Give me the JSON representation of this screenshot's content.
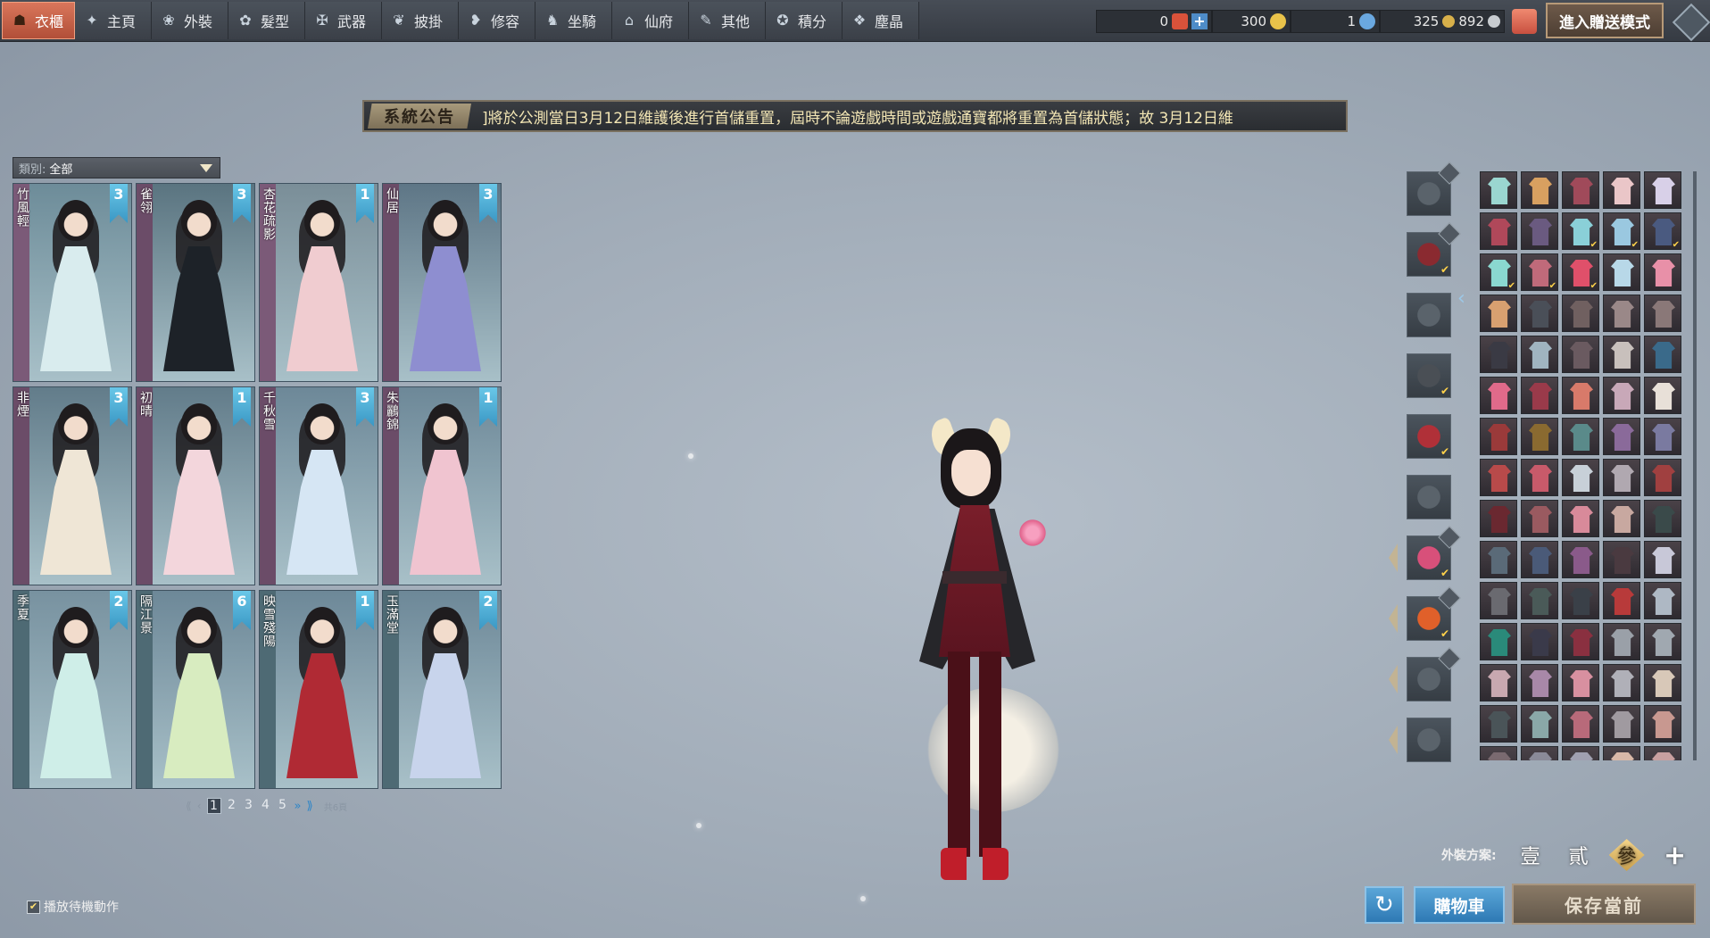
{
  "tabs": [
    {
      "label": "衣櫃",
      "icon": "wardrobe-icon",
      "glyph": "☗",
      "active": true
    },
    {
      "label": "主頁",
      "icon": "home-icon",
      "glyph": "✦"
    },
    {
      "label": "外裝",
      "icon": "outfit-icon",
      "glyph": "❀"
    },
    {
      "label": "髮型",
      "icon": "hairstyle-icon",
      "glyph": "✿"
    },
    {
      "label": "武器",
      "icon": "weapon-icon",
      "glyph": "✠"
    },
    {
      "label": "披掛",
      "icon": "cape-icon",
      "glyph": "❦"
    },
    {
      "label": "修容",
      "icon": "makeup-icon",
      "glyph": "❥"
    },
    {
      "label": "坐騎",
      "icon": "mount-icon",
      "glyph": "♞"
    },
    {
      "label": "仙府",
      "icon": "residence-icon",
      "glyph": "⌂"
    },
    {
      "label": "其他",
      "icon": "other-icon",
      "glyph": "✎"
    },
    {
      "label": "積分",
      "icon": "points-icon",
      "glyph": "✪"
    },
    {
      "label": "塵晶",
      "icon": "dust-crystal-icon",
      "glyph": "❖"
    }
  ],
  "currency": {
    "c1": {
      "value": "0",
      "icon": "red-token-icon",
      "color": "#d9523a"
    },
    "c2": {
      "value": "300",
      "icon": "gold-star-icon",
      "color": "#e8c24a"
    },
    "c3": {
      "value": "1",
      "icon": "shield-token-icon",
      "color": "#6aa8e0"
    },
    "c4": {
      "value": "325",
      "icon": "gold-coin-icon",
      "color": "#d8b04a"
    },
    "c5": {
      "value": "892",
      "icon": "silver-coin-icon",
      "color": "#c8ccd0"
    }
  },
  "gift_mode_label": "進入贈送模式",
  "notice": {
    "label": "系統公告",
    "text": "]將於公測當日3月12日維護後進行首儲重置，屆時不論遊戲時間或遊戲通寶都將重置為首儲狀態；故 3月12日維"
  },
  "category": {
    "label": "類別:",
    "value": "全部"
  },
  "outfits": [
    {
      "name": "竹風輕",
      "count": "3",
      "stripe": "#7b5a78",
      "bg": "#6d8c99",
      "robe": "#d9ecee"
    },
    {
      "name": "雀翎",
      "count": "3",
      "stripe": "#6b4c68",
      "bg": "#5a7480",
      "robe": "#1d2228"
    },
    {
      "name": "杏花疏影",
      "count": "1",
      "stripe": "#7b5a78",
      "bg": "#7a8e98",
      "robe": "#f0ccd0"
    },
    {
      "name": "仙居",
      "count": "3",
      "stripe": "#6b4c68",
      "bg": "#5e7686",
      "robe": "#8e8ed0"
    },
    {
      "name": "非煙",
      "count": "3",
      "stripe": "#6b4c68",
      "bg": "#627c8a",
      "robe": "#efe6d6"
    },
    {
      "name": "初晴",
      "count": "1",
      "stripe": "#6b4c68",
      "bg": "#627c8a",
      "robe": "#f3d6dc"
    },
    {
      "name": "千秋雪",
      "count": "3",
      "stripe": "#6b4c68",
      "bg": "#6d8898",
      "robe": "#d6e6f4"
    },
    {
      "name": "朱鸝錦",
      "count": "1",
      "stripe": "#6b4c68",
      "bg": "#6d8898",
      "robe": "#f0c4d0"
    },
    {
      "name": "季夏",
      "count": "2",
      "stripe": "#4e6a74",
      "bg": "#7892a0",
      "robe": "#cfeee8"
    },
    {
      "name": "隔江景",
      "count": "6",
      "stripe": "#4e6a74",
      "bg": "#6d8898",
      "robe": "#d8ecc0"
    },
    {
      "name": "映雪殘陽",
      "count": "1",
      "stripe": "#4e6a74",
      "bg": "#6d8898",
      "robe": "#b02a34"
    },
    {
      "name": "玉滿堂",
      "count": "2",
      "stripe": "#4e6a74",
      "bg": "#6d8898",
      "robe": "#c8d4ec"
    }
  ],
  "pagination": {
    "first": "⟪",
    "prev": "‹",
    "pages": [
      "1",
      "2",
      "3",
      "4",
      "5"
    ],
    "current": "1",
    "next": "»",
    "last": "⟫",
    "total": "共6頁"
  },
  "idle_label": "播放待機動作",
  "slots": [
    {
      "icon": "hair-slot-icon",
      "color": "#5a636b",
      "eye": true,
      "check": false,
      "arrow": false
    },
    {
      "icon": "cape-slot-icon",
      "color": "#8a2a30",
      "eye": true,
      "check": true,
      "arrow": false
    },
    {
      "icon": "top-slot-icon",
      "color": "#5a636b",
      "eye": false,
      "check": false,
      "arrow": false
    },
    {
      "icon": "bracer-slot-icon",
      "color": "#4a4f55",
      "eye": false,
      "check": true,
      "arrow": false
    },
    {
      "icon": "shoes-slot-icon",
      "color": "#b03038",
      "eye": false,
      "check": true,
      "arrow": false
    },
    {
      "icon": "skirt-slot-icon",
      "color": "#5a636b",
      "eye": false,
      "check": false,
      "arrow": false
    },
    {
      "icon": "flower-accessory-icon",
      "color": "#d8507a",
      "eye": true,
      "check": true,
      "arrow": true
    },
    {
      "icon": "gourd-accessory-icon",
      "color": "#e0602a",
      "eye": true,
      "check": true,
      "arrow": true
    },
    {
      "icon": "back-accessory-icon",
      "color": "#5a636b",
      "eye": true,
      "check": false,
      "arrow": true
    },
    {
      "icon": "wings-slot-icon",
      "color": "#5a636b",
      "eye": false,
      "check": false,
      "arrow": true
    }
  ],
  "grid_palette": [
    "#9ad6d0",
    "#d8a060",
    "#a04a5a",
    "#eac6c8",
    "#d8d0e8",
    "#b0485a",
    "#6a5a80",
    "#8ad0d8",
    "#9ac8e0",
    "#4a5a80",
    "#8ad8d0",
    "#c06a7a",
    "#e0506a",
    "#b8d8e8",
    "#e890a8",
    "#d8a070",
    "#4a4f58",
    "#706060",
    "#9a8888",
    "#8a7878",
    "#3a3a44",
    "#a0b4c0",
    "#6a5a60",
    "#c8c0bc",
    "#3a6a8a",
    "#e06a8a",
    "#9a3a4a",
    "#d87a6a",
    "#c8a8b8",
    "#e8e0d8",
    "#9a3a3a",
    "#8a6a30",
    "#5a8a8a",
    "#8a6a9a",
    "#7a7aa0",
    "#b84a4a",
    "#c85a6a",
    "#c8d0d8",
    "#b0a8b0",
    "#a04040",
    "#6a2830",
    "#9a5a60",
    "#d88a9a",
    "#c8a8a0",
    "#3a4a4a",
    "#5a6a78",
    "#4a5a78",
    "#8a5a8a",
    "#4a3a40",
    "#c8c8d8",
    "#6a6a70",
    "#4a5a58",
    "#3a4048",
    "#b83a3a",
    "#aeb8c4",
    "#2a8a7a",
    "#3a3a4a",
    "#8a3040",
    "#9aa0a8",
    "#a0a8b0",
    "#c8a8b0",
    "#a888a8",
    "#d890a0",
    "#b0b0b8",
    "#d8c8b8",
    "#4a5458",
    "#8aa8a8",
    "#b86a7a",
    "#a09aa0",
    "#c89890",
    "#7a6a70",
    "#8a8a98",
    "#a0a0b0",
    "#d8b8a8",
    "#c8a0a0"
  ],
  "grid_checked": [
    7,
    8,
    9,
    10,
    11,
    12
  ],
  "presets": {
    "label": "外裝方案:",
    "items": [
      "壹",
      "貳",
      "參"
    ],
    "active": 2,
    "add": "+"
  },
  "buttons": {
    "undo": "↻",
    "cart": "購物車",
    "save": "保存當前"
  }
}
